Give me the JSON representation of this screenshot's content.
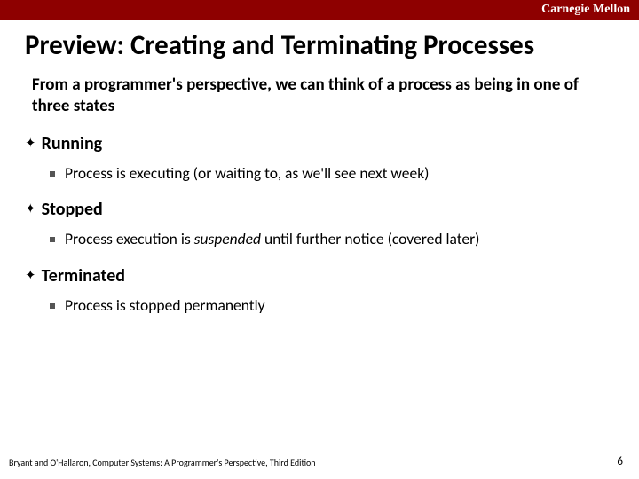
{
  "header": {
    "brand": "Carnegie Mellon"
  },
  "title": "Preview: Creating and Terminating Processes",
  "intro": "From a programmer's perspective, we can think of a process as being in one of three states",
  "states": {
    "running": {
      "label": "Running",
      "desc": "Process is executing (or waiting to, as we'll see next week)"
    },
    "stopped": {
      "label": "Stopped",
      "desc_pre": "Process execution is ",
      "desc_em": "suspended",
      "desc_post": " until further notice (covered later)"
    },
    "terminated": {
      "label": "Terminated",
      "desc": "Process is stopped permanently"
    }
  },
  "footer": {
    "citation": "Bryant and O'Hallaron, Computer Systems: A Programmer's Perspective, Third Edition",
    "page": "6"
  }
}
